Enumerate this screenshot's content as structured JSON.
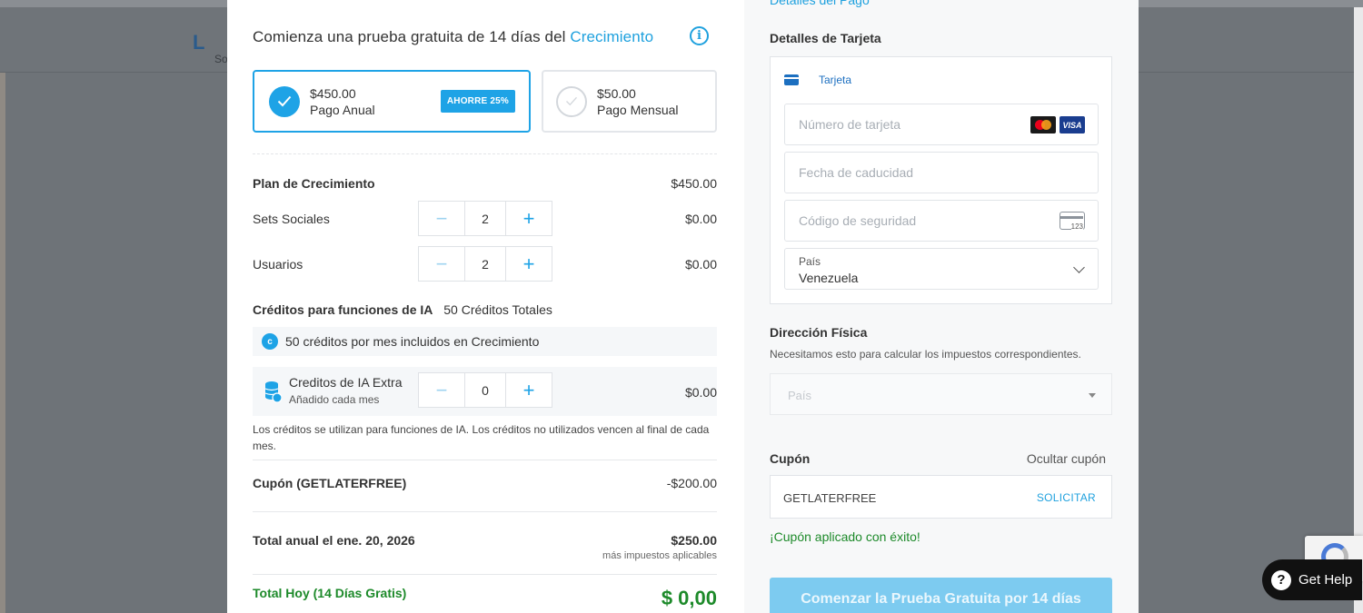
{
  "backdrop": {
    "logo_text": "L",
    "logo_sub": "So"
  },
  "trial": {
    "title_prefix": "Comienza una prueba gratuita de 14 días del ",
    "plan_name": "Crecimiento",
    "info_glyph": "i"
  },
  "plans": {
    "annual": {
      "price": "$450.00",
      "label": "Pago Anual",
      "badge": "AHORRE 25%"
    },
    "monthly": {
      "price": "$50.00",
      "label": "Pago Mensual"
    }
  },
  "summary": {
    "plan_label": "Plan de Crecimiento",
    "plan_price": "$450.00",
    "social_sets": {
      "label": "Sets Sociales",
      "value": "2",
      "price": "$0.00"
    },
    "users": {
      "label": "Usuarios",
      "value": "2",
      "price": "$0.00"
    },
    "ai_credits_label": "Créditos para funciones de IA",
    "ai_credits_total": "50 Créditos Totales",
    "included_credits": "50 créditos por mes incluidos en Crecimiento",
    "credit_icon_glyph": "c",
    "extra": {
      "title": "Creditos de IA Extra",
      "subtitle": "Añadido cada mes",
      "value": "0",
      "price": "$0.00"
    },
    "note": "Los créditos se utilizan para funciones de IA. Los créditos no utilizados vencen al final de cada mes.",
    "coupon_label": "Cupón (GETLATERFREE)",
    "coupon_price": "-$200.00",
    "annual_total_label": "Total anual el ene. 20, 2026",
    "annual_total_price": "$250.00",
    "taxes_note": "más impuestos aplicables",
    "today_label": "Total Hoy (14 Días Gratis)",
    "today_price": "$ 0,00"
  },
  "stepper": {
    "minus": "−",
    "plus": "+"
  },
  "payment": {
    "top_link": "Detalles del Pago",
    "card_section_title": "Detalles de Tarjeta",
    "card_tab": "Tarjeta",
    "card_number_placeholder": "Número de tarjeta",
    "expiry_placeholder": "Fecha de caducidad",
    "cvc_placeholder": "Código de seguridad",
    "cvc_icon_text": "123",
    "visa_text": "VISA",
    "country_label": "País",
    "country_value": "Venezuela"
  },
  "address": {
    "title": "Dirección Física",
    "subtitle": "Necesitamos esto para calcular los impuestos correspondientes.",
    "country_placeholder": "País"
  },
  "coupon": {
    "title": "Cupón",
    "hide_link": "Ocultar cupón",
    "code": "GETLATERFREE",
    "apply": "SOLICITAR",
    "success": "¡Cupón aplicado con éxito!"
  },
  "cta": {
    "label": "Comenzar la Prueba Gratuita por 14 días"
  },
  "help": {
    "label": "Get Help",
    "glyph": "?"
  },
  "colors": {
    "accent": "#1ea3e6",
    "success": "#1d8a2a",
    "cta_disabled": "#7dcbf0"
  }
}
